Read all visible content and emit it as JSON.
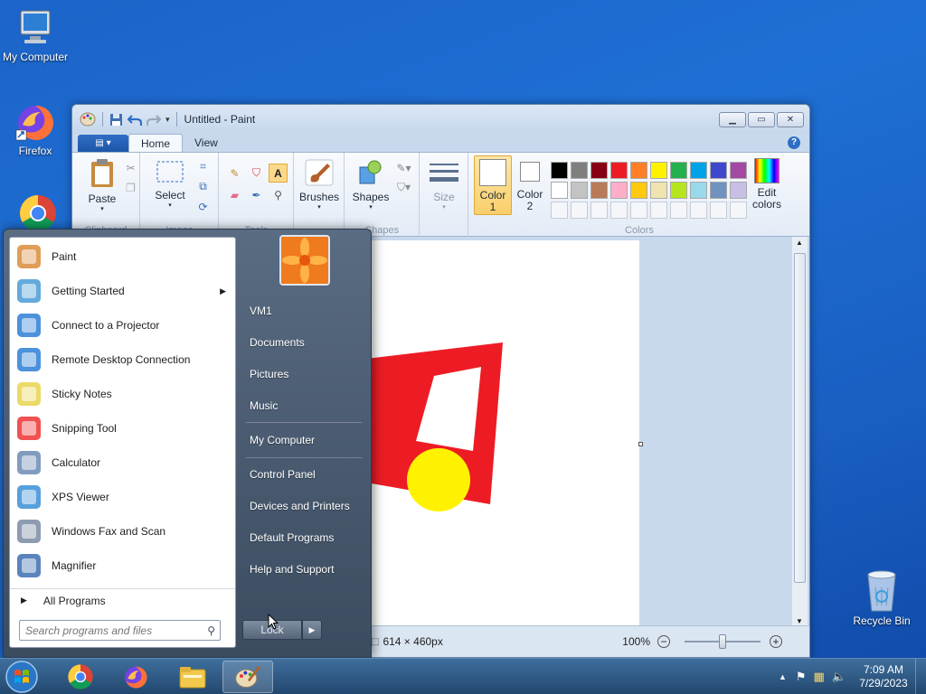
{
  "desktop": {
    "icons": [
      {
        "label": "My Computer",
        "icon": "computer-icon"
      },
      {
        "label": "Firefox",
        "icon": "firefox-icon"
      },
      {
        "label": "Recycle Bin",
        "icon": "recycle-bin-icon"
      }
    ]
  },
  "paint": {
    "title": "Untitled - Paint",
    "tabs": {
      "home": "Home",
      "view": "View"
    },
    "ribbon": {
      "paste": "Paste",
      "clipboard": "Clipboard",
      "select": "Select",
      "image": "Image",
      "tools": "Tools",
      "brushes": "Brushes",
      "shapes": "Shapes",
      "shapes_group": "Shapes",
      "size": "Size",
      "color1_line1": "Color",
      "color1_line2": "1",
      "color2_line1": "Color",
      "color2_line2": "2",
      "edit_colors_line1": "Edit",
      "edit_colors_line2": "colors",
      "colors_group": "Colors",
      "palette_row1": [
        "#000000",
        "#7f7f7f",
        "#880015",
        "#ed1c24",
        "#ff7f27",
        "#fff200",
        "#22b14c",
        "#00a2e8",
        "#3f48cc",
        "#a349a4"
      ],
      "palette_row2": [
        "#ffffff",
        "#c3c3c3",
        "#b97a57",
        "#ffaec9",
        "#ffc90e",
        "#efe4b0",
        "#b5e61d",
        "#99d9ea",
        "#7092be",
        "#c8bfe7"
      ]
    },
    "drawing": {
      "shape_color": "#ed1c24",
      "circle_color": "#fff200"
    },
    "status": {
      "canvas_size": "614 × 460px",
      "zoom": "100%"
    }
  },
  "start_menu": {
    "programs": [
      {
        "label": "Paint",
        "icon": "paint-icon"
      },
      {
        "label": "Getting Started",
        "icon": "getting-started-icon",
        "has_submenu": true
      },
      {
        "label": "Connect to a Projector",
        "icon": "projector-icon"
      },
      {
        "label": "Remote Desktop Connection",
        "icon": "remote-desktop-icon"
      },
      {
        "label": "Sticky Notes",
        "icon": "sticky-notes-icon"
      },
      {
        "label": "Snipping Tool",
        "icon": "snipping-tool-icon"
      },
      {
        "label": "Calculator",
        "icon": "calculator-icon"
      },
      {
        "label": "XPS Viewer",
        "icon": "xps-viewer-icon"
      },
      {
        "label": "Windows Fax and Scan",
        "icon": "fax-icon"
      },
      {
        "label": "Magnifier",
        "icon": "magnifier-icon"
      }
    ],
    "all_programs": "All Programs",
    "search_placeholder": "Search programs and files",
    "right": {
      "user": "VM1",
      "documents": "Documents",
      "pictures": "Pictures",
      "music": "Music",
      "my_computer": "My Computer",
      "control_panel": "Control Panel",
      "devices": "Devices and Printers",
      "default_programs": "Default Programs",
      "help": "Help and Support"
    },
    "lock": "Lock"
  },
  "taskbar": {
    "apps": [
      "chrome-icon",
      "firefox-icon",
      "file-explorer-icon",
      "paint-icon"
    ],
    "clock_time": "7:09 AM",
    "clock_date": "7/29/2023"
  }
}
